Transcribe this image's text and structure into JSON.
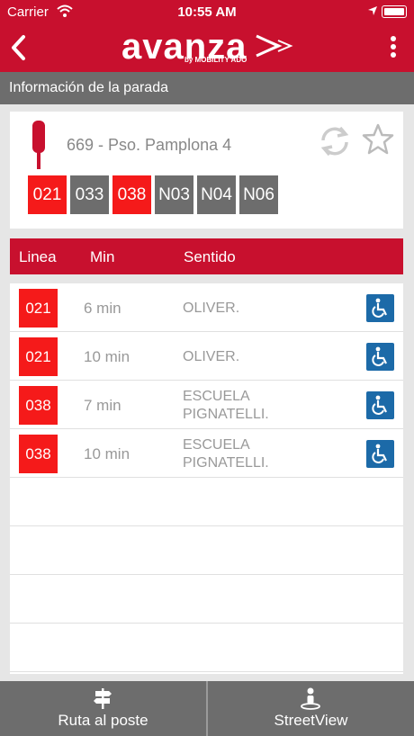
{
  "status_bar": {
    "carrier": "Carrier",
    "time": "10:55 AM"
  },
  "app": {
    "logo_text": "avanza",
    "logo_subtext": "by MOBILITY ADO",
    "brand_color": "#c8102e"
  },
  "section_title": "Información de la parada",
  "stop": {
    "name": "669 - Pso. Pamplona 4",
    "lines": [
      {
        "code": "021",
        "active": true
      },
      {
        "code": "033",
        "active": false
      },
      {
        "code": "038",
        "active": true
      },
      {
        "code": "N03",
        "active": false
      },
      {
        "code": "N04",
        "active": false
      },
      {
        "code": "N06",
        "active": false
      }
    ]
  },
  "table": {
    "headers": {
      "line": "Linea",
      "min": "Min",
      "direction": "Sentido"
    },
    "rows": [
      {
        "line": "021",
        "min": "6 min",
        "direction": [
          "OLIVER."
        ]
      },
      {
        "line": "021",
        "min": "10 min",
        "direction": [
          "OLIVER."
        ]
      },
      {
        "line": "038",
        "min": "7 min",
        "direction": [
          "ESCUELA",
          "PIGNATELLI."
        ]
      },
      {
        "line": "038",
        "min": "10 min",
        "direction": [
          "ESCUELA",
          "PIGNATELLI."
        ]
      }
    ]
  },
  "bottom_tabs": [
    {
      "label": "Ruta al poste",
      "icon": "signpost-icon"
    },
    {
      "label": "StreetView",
      "icon": "pegman-icon"
    }
  ],
  "colors": {
    "active_line": "#f51a1a",
    "inactive_line": "#6d6d6d",
    "accessible": "#1c6aa8"
  }
}
